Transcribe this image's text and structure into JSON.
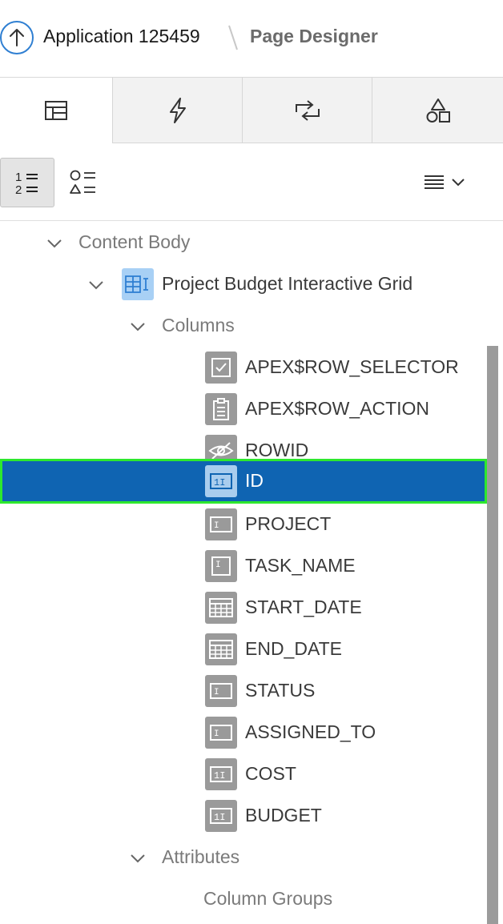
{
  "header": {
    "app_title": "Application 125459",
    "current_page": "Page Designer"
  },
  "tabs": [
    {
      "icon": "rendering-icon",
      "active": true
    },
    {
      "icon": "lightning-icon",
      "active": false
    },
    {
      "icon": "process-icon",
      "active": false
    },
    {
      "icon": "shared-components-icon",
      "active": false
    }
  ],
  "toolbar": {
    "group_by_order_icon": "numbered-list-icon",
    "group_by_component_icon": "component-list-icon",
    "menu_icon": "menu-lines-icon"
  },
  "tree": {
    "content_body": "Content Body",
    "region": "Project Budget Interactive Grid",
    "columns_folder": "Columns",
    "columns": [
      {
        "name": "APEX$ROW_SELECTOR",
        "icon": "checkbox-icon"
      },
      {
        "name": "APEX$ROW_ACTION",
        "icon": "clipboard-icon"
      },
      {
        "name": "ROWID",
        "icon": "hidden-eye-icon"
      },
      {
        "name": "ID",
        "icon": "number-field-icon",
        "selected": true
      },
      {
        "name": "PROJECT",
        "icon": "text-field-icon"
      },
      {
        "name": "TASK_NAME",
        "icon": "textarea-icon"
      },
      {
        "name": "START_DATE",
        "icon": "calendar-icon"
      },
      {
        "name": "END_DATE",
        "icon": "calendar-icon"
      },
      {
        "name": "STATUS",
        "icon": "text-field-icon"
      },
      {
        "name": "ASSIGNED_TO",
        "icon": "text-field-icon"
      },
      {
        "name": "COST",
        "icon": "number-field-icon"
      },
      {
        "name": "BUDGET",
        "icon": "number-field-icon"
      }
    ],
    "attributes_folder": "Attributes",
    "column_groups": "Column Groups"
  },
  "colors": {
    "accent": "#2f7fd2",
    "selected_bg": "#0f64b2",
    "selected_outline": "#2ee82e",
    "icon_gray": "#9a9a9a"
  }
}
